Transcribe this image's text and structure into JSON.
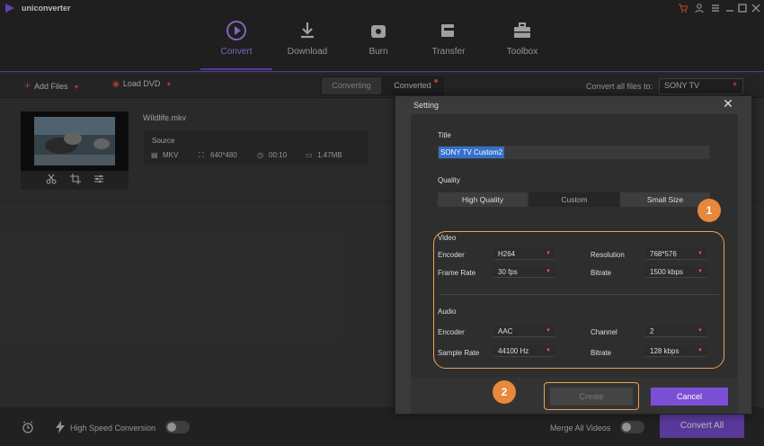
{
  "app": {
    "title": "uniconverter"
  },
  "nav": {
    "tabs": [
      {
        "label": "Convert",
        "icon": "convert-icon",
        "active": true
      },
      {
        "label": "Download",
        "icon": "download-icon",
        "active": false
      },
      {
        "label": "Burn",
        "icon": "disc-icon",
        "active": false
      },
      {
        "label": "Transfer",
        "icon": "transfer-icon",
        "active": false
      },
      {
        "label": "Toolbox",
        "icon": "toolbox-icon",
        "active": false
      }
    ]
  },
  "toolbar": {
    "add_files": "Add Files",
    "load_dvd": "Load DVD",
    "tab_converting": "Converting",
    "tab_converted": "Converted",
    "convert_all_files_to": "Convert all files to:",
    "format": "SONY TV"
  },
  "file": {
    "name": "Wildlife.mkv",
    "source_label": "Source",
    "container": "MKV",
    "resolution": "640*480",
    "duration": "00:10",
    "size": "1.47MB"
  },
  "bottom": {
    "high_speed": "High Speed Conversion",
    "merge": "Merge All Videos",
    "convert_all": "Convert All"
  },
  "dialog": {
    "title": "Setting",
    "title_label": "Title",
    "title_value": "SONY TV Custom2",
    "quality_label": "Quality",
    "quality_options": [
      "High Quality",
      "Custom",
      "Small Size"
    ],
    "quality_selected": "Custom",
    "video_label": "Video",
    "video": {
      "encoder_label": "Encoder",
      "encoder": "H264",
      "frame_rate_label": "Frame Rate",
      "frame_rate": "30 fps",
      "resolution_label": "Resolution",
      "resolution": "768*576",
      "bitrate_label": "Bitrate",
      "bitrate": "1500 kbps"
    },
    "audio_label": "Audio",
    "audio": {
      "encoder_label": "Encoder",
      "encoder": "AAC",
      "sample_rate_label": "Sample Rate",
      "sample_rate": "44100 Hz",
      "channel_label": "Channel",
      "channel": "2",
      "bitrate_label": "Bitrate",
      "bitrate": "128 kbps"
    },
    "create": "Create",
    "cancel": "Cancel"
  },
  "badges": [
    "1",
    "2"
  ],
  "colors": {
    "accent": "#7a4fd6",
    "orange": "#e8883d",
    "selection": "#3470c9"
  }
}
